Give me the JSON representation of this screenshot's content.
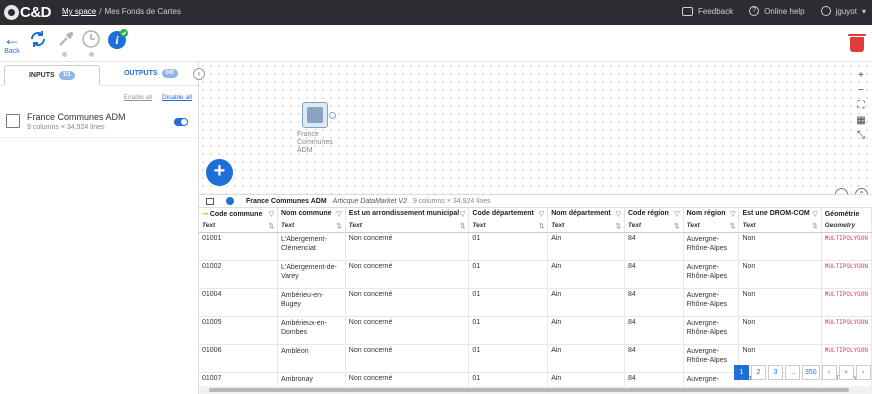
{
  "app": {
    "logo": "C&D"
  },
  "breadcrumb": {
    "root": "My space",
    "current": "Mes Fonds de Cartes"
  },
  "topbar": {
    "feedback": "Feedback",
    "help": "Online help",
    "user": "jguyot"
  },
  "toolbar": {
    "back_label": "Back"
  },
  "left_panel": {
    "tabs": [
      {
        "label": "INPUTS",
        "badge": "1/1"
      },
      {
        "label": "OUTPUTS",
        "badge": "0/0"
      }
    ],
    "enable_all": "Enable all",
    "disable_all": "Disable all",
    "input": {
      "name": "France Communes ADM",
      "meta": "9 columns × 34,924 lines",
      "enabled": true
    }
  },
  "canvas": {
    "node_label": "France Communes ADM"
  },
  "grid": {
    "dataset": "France Communes ADM",
    "source": "Articque DataMarket V2",
    "meta": "9 columns × 34,924 lines",
    "columns": [
      {
        "name": "Code commune",
        "type": "Text"
      },
      {
        "name": "Nom commune",
        "type": "Text"
      },
      {
        "name": "Est un arrondissement municipal",
        "type": "Text"
      },
      {
        "name": "Code département",
        "type": "Text"
      },
      {
        "name": "Nom département",
        "type": "Text"
      },
      {
        "name": "Code région",
        "type": "Text"
      },
      {
        "name": "Nom région",
        "type": "Text"
      },
      {
        "name": "Est une DROM-COM",
        "type": "Text"
      },
      {
        "name": "Géométrie",
        "type": "Geometry"
      }
    ],
    "rows": [
      [
        "01001",
        "L'Abergement-Clémenciat",
        "Non concerné",
        "01",
        "Ain",
        "84",
        "Auvergne-Rhône-Alpes",
        "Non",
        "MULTIPOLYGON"
      ],
      [
        "01002",
        "L'Abergement-de-Varey",
        "Non concerné",
        "01",
        "Ain",
        "84",
        "Auvergne-Rhône-Alpes",
        "Non",
        "MULTIPOLYGON"
      ],
      [
        "01004",
        "Ambérieu-en-Bugey",
        "Non concerné",
        "01",
        "Ain",
        "84",
        "Auvergne-Rhône-Alpes",
        "Non",
        "MULTIPOLYGON"
      ],
      [
        "01005",
        "Ambérieux-en-Dombes",
        "Non concerné",
        "01",
        "Ain",
        "84",
        "Auvergne-Rhône-Alpes",
        "Non",
        "MULTIPOLYGON"
      ],
      [
        "01006",
        "Ambléon",
        "Non concerné",
        "01",
        "Ain",
        "84",
        "Auvergne-Rhône-Alpes",
        "Non",
        "MULTIPOLYGON"
      ],
      [
        "01007",
        "Ambronay",
        "Non concerné",
        "01",
        "Ain",
        "84",
        "Auvergne-",
        "Non",
        "MULTIPOLYGON"
      ]
    ]
  },
  "pagination": {
    "pages": [
      "1",
      "2",
      "3",
      "...",
      "350"
    ],
    "current": "1"
  },
  "colors": {
    "accent": "#1f6fd8",
    "topbar": "#2b2d32",
    "danger": "#e03a3a",
    "geometry_text": "#d4357a"
  }
}
